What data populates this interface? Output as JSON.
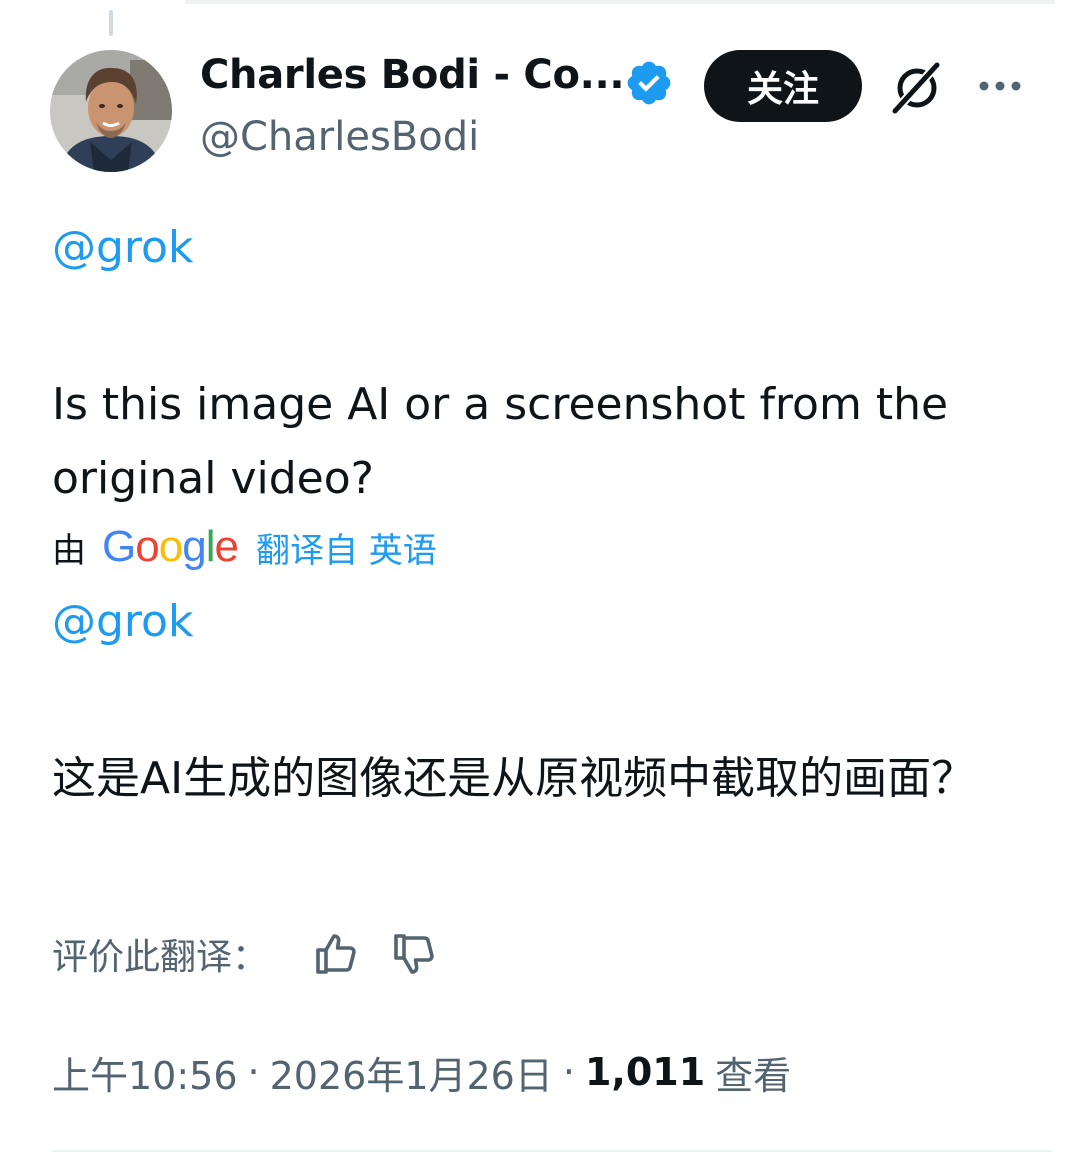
{
  "author": {
    "name": "Charles Bodi - Co...",
    "handle": "@CharlesBodi",
    "verified": true
  },
  "header": {
    "follow_label": "关注",
    "grok_icon": "grok-slash-icon",
    "more_icon": "more-horizontal-icon"
  },
  "tweet": {
    "mention": "@grok",
    "text": "Is this image AI or a screenshot from the original video?"
  },
  "translation": {
    "prefix": "由",
    "provider": [
      "G",
      "o",
      "o",
      "g",
      "l",
      "e"
    ],
    "provider_colors": [
      "#4285F4",
      "#EA4335",
      "#FBBC05",
      "#4285F4",
      "#34A853",
      "#EA4335"
    ],
    "link": "翻译自 英语",
    "mention": "@grok",
    "text": "这是AI生成的图像还是从原视频中截取的画面？",
    "rate_label": "评价此翻译：",
    "thumbs_up_icon": "thumbs-up-icon",
    "thumbs_down_icon": "thumbs-down-icon"
  },
  "meta": {
    "time": "上午10:56",
    "separator": "·",
    "date": "2026年1月26日",
    "views_count": "1,011",
    "views_label": "查看"
  },
  "colors": {
    "accent": "#1d9bf0",
    "text": "#0f1419",
    "secondary": "#536471",
    "verified": "#1d9bf0"
  }
}
